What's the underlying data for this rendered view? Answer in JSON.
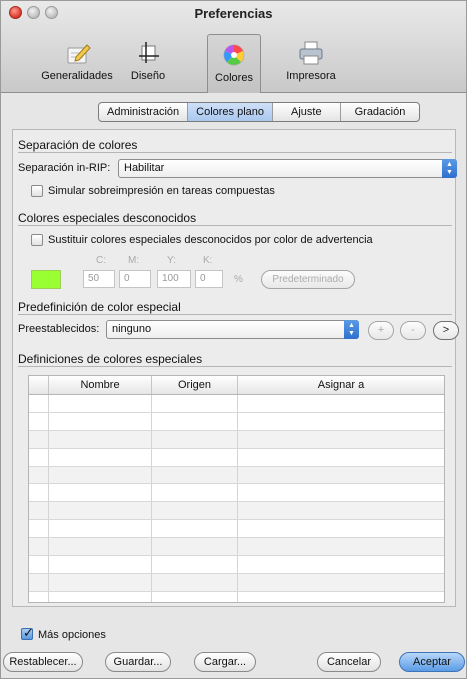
{
  "window": {
    "title": "Preferencias"
  },
  "toolbar": {
    "items": [
      {
        "label": "Generalidades",
        "icon": "pencil-icon"
      },
      {
        "label": "Diseño",
        "icon": "crop-icon"
      },
      {
        "label": "Colores",
        "icon": "color-wheel-icon",
        "selected": true
      },
      {
        "label": "Impresora",
        "icon": "printer-icon"
      }
    ]
  },
  "tabs": [
    {
      "label": "Administración"
    },
    {
      "label": "Colores plano",
      "active": true
    },
    {
      "label": "Ajuste"
    },
    {
      "label": "Gradación"
    }
  ],
  "separation": {
    "title": "Separación de colores",
    "inrip_label": "Separación in-RIP:",
    "inrip_value": "Habilitar",
    "simulate_label": "Simular sobreimpresión en tareas compuestas",
    "simulate_checked": false
  },
  "unknown_spot": {
    "title": "Colores especiales desconocidos",
    "replace_label": "Sustituir colores especiales desconocidos por color de advertencia",
    "replace_checked": false,
    "c_label": "C:",
    "m_label": "M:",
    "y_label": "Y:",
    "k_label": "K:",
    "c_value": "50",
    "m_value": "0",
    "y_value": "100",
    "k_value": "0",
    "percent": "%",
    "swatch_color": "#99ff33",
    "default_button": "Predeterminado"
  },
  "spot_preset": {
    "title": "Predefinición de color especial",
    "label": "Preestablecidos:",
    "value": "ninguno",
    "add": "+",
    "remove": "-",
    "next": ">"
  },
  "spot_definitions": {
    "title": "Definiciones de colores especiales",
    "columns": [
      "Nombre",
      "Origen",
      "Asignar a"
    ],
    "row_count": 12
  },
  "footer": {
    "more_options": "Más opciones",
    "more_options_checked": true,
    "reset": "Restablecer...",
    "save": "Guardar...",
    "load": "Cargar...",
    "cancel": "Cancelar",
    "accept": "Aceptar"
  }
}
